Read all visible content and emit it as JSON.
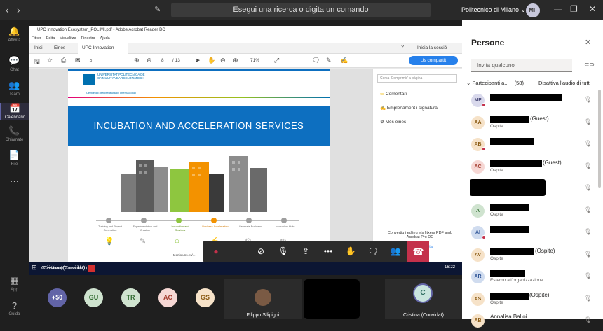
{
  "titlebar": {
    "back": "‹",
    "forward": "›",
    "search_placeholder": "Esegui una ricerca o digita un comando",
    "org": "Politecnico di Milano ⌄",
    "me_initials": "MF"
  },
  "rail": [
    {
      "icon": "bell-icon",
      "glyph": "🔔",
      "label": "Attività"
    },
    {
      "icon": "chat-icon",
      "glyph": "💬",
      "label": "Chat"
    },
    {
      "icon": "teams-icon",
      "glyph": "👥",
      "label": "Team"
    },
    {
      "icon": "calendar-icon",
      "glyph": "📅",
      "label": "Calendario"
    },
    {
      "icon": "phone-icon",
      "glyph": "📞",
      "label": "Chiamate"
    },
    {
      "icon": "file-icon",
      "glyph": "📄",
      "label": "File"
    },
    {
      "icon": "more-icon",
      "glyph": "···",
      "label": ""
    },
    {
      "icon": "apps-icon",
      "glyph": "▦",
      "label": "App"
    },
    {
      "icon": "help-icon",
      "glyph": "?",
      "label": "Guida"
    }
  ],
  "acrobat": {
    "window_title": "UPC Innovation Ecosystem_POLIMI.pdf - Adobe Acrobat Reader DC",
    "menu": [
      "Fitxer",
      "Edita",
      "Visualitza",
      "Finestra",
      "Ajuda"
    ],
    "tabs": [
      "Inici",
      "Eines",
      "UPC Innovation Ec..."
    ],
    "signin": "Inicia la sessió",
    "page_current": "8",
    "page_total": "/ 13",
    "zoom": "71%",
    "share_button": "Us compartit",
    "search_placeholder": "Cerca 'Comprimir' a pàgina",
    "right_items": [
      "Comentari",
      "Emplenament i signatura",
      "Més eines"
    ],
    "convert_note": "Convertiu i editeu els fitxers PDF amb Acrobat Pro DC",
    "convert_link": "ulta"
  },
  "pdf": {
    "upc_name": "UNIVERSITAT POLITÈCNICA DE CATALUNYA BARCELONATECH",
    "upc_sub": "Centre d'Enterpreneurship Internacional",
    "banner": "INCUBATION AND ACCELERATION SERVICES",
    "steps": [
      "Training and Project Generation",
      "Experimentation and Creation",
      "Incubation and Services",
      "Business Acceleration",
      "Generate Business",
      "Innovation Hubs"
    ],
    "url_snip": "tecnio.uns.es/..."
  },
  "taskbar": {
    "time": "16:22",
    "user": "Cristina (Convidat)"
  },
  "presenter": "Cristina (Convidat)",
  "bottom": {
    "bubbles": [
      {
        "label": "+50",
        "bg": "#6264a7",
        "fg": "#ffffff"
      },
      {
        "label": "GU",
        "bg": "#cfe3cf",
        "fg": "#316c31"
      },
      {
        "label": "TR",
        "bg": "#cfe3cf",
        "fg": "#316c31"
      },
      {
        "label": "AC",
        "bg": "#f6d7d4",
        "fg": "#a33b2d"
      },
      {
        "label": "GS",
        "bg": "#f6e2c8",
        "fg": "#8a5a12"
      }
    ],
    "filippo": "Filippo Silipigni",
    "cristina_tile": "Cristina (Convidat)",
    "cristina_initial": "C"
  },
  "people": {
    "title": "Persone",
    "invite_placeholder": "Invita qualcuno",
    "section": "Partecipanti a...",
    "count": "(58)",
    "mute_all": "Disattiva l'audio di tutti",
    "list": [
      {
        "initials": "MF",
        "bg": "#d9d9ec",
        "fg": "#464775",
        "name": "",
        "suffix": "",
        "sub": "",
        "redact": 103,
        "dot": true
      },
      {
        "initials": "AA",
        "bg": "#f6e2c8",
        "fg": "#8a5a12",
        "name": "",
        "suffix": "(Guest)",
        "sub": "Ospite",
        "redact": 56,
        "dot": false
      },
      {
        "initials": "AB",
        "bg": "#f6e2c8",
        "fg": "#8a5a12",
        "name": "",
        "suffix": "",
        "sub": "",
        "redact": 62,
        "dot": true
      },
      {
        "initials": "AC",
        "bg": "#f6d7d4",
        "fg": "#a33b2d",
        "name": "",
        "suffix": "(Guest)",
        "sub": "Ospite",
        "redact": 74,
        "dot": false
      },
      {
        "initials": "",
        "bg": "#ffffff",
        "fg": "#000",
        "name": "",
        "suffix": "",
        "sub": "",
        "redact": 108,
        "dot": false
      },
      {
        "initials": "A",
        "bg": "#cfe3cf",
        "fg": "#316c31",
        "name": "",
        "suffix": "",
        "sub": "Ospite",
        "redact": 55,
        "dot": false
      },
      {
        "initials": "AI",
        "bg": "#d0dcef",
        "fg": "#2f5597",
        "name": "",
        "suffix": "",
        "sub": "",
        "redact": 55,
        "dot": true
      },
      {
        "initials": "AV",
        "bg": "#f6e2c8",
        "fg": "#8a5a12",
        "name": "",
        "suffix": "(Ospite)",
        "sub": "Ospite",
        "redact": 63,
        "dot": false
      },
      {
        "initials": "AR",
        "bg": "#d0dcef",
        "fg": "#2f5597",
        "name": "",
        "suffix": "",
        "sub": "Esterno all'organizzazione",
        "redact": 50,
        "dot": false
      },
      {
        "initials": "AS",
        "bg": "#f6e2c8",
        "fg": "#8a5a12",
        "name": "",
        "suffix": "(Ospite)",
        "sub": "Ospite",
        "redact": 55,
        "dot": false
      },
      {
        "initials": "AB",
        "bg": "#f6e2c8",
        "fg": "#8a5a12",
        "name": "Annalisa Balloi",
        "suffix": "",
        "sub": "",
        "redact": 0,
        "dot": false
      }
    ]
  }
}
